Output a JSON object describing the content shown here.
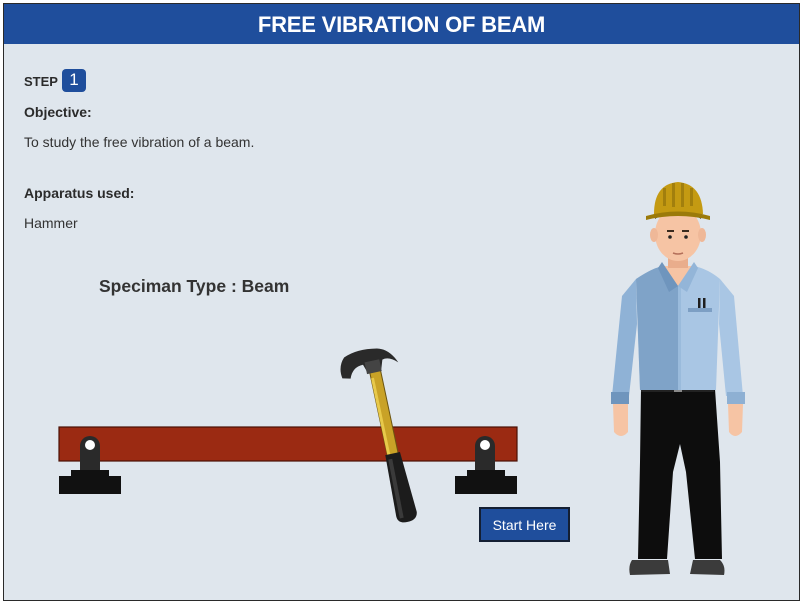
{
  "header": {
    "title": "FREE VIBRATION OF BEAM"
  },
  "step": {
    "label": "STEP",
    "number": "1"
  },
  "objective": {
    "heading": "Objective:",
    "text": "To study the free vibration of a beam."
  },
  "apparatus": {
    "heading": "Apparatus used:",
    "text": "Hammer"
  },
  "specimen": {
    "label": "Speciman Type : Beam"
  },
  "actions": {
    "start_label": "Start Here"
  },
  "colors": {
    "header": "#1f4e9c",
    "background": "#dfe6ed",
    "beam": "#9b2a12",
    "button": "#1f4e9c"
  },
  "icons": [
    "beam-support-icon",
    "hammer-icon",
    "engineer-figure-icon"
  ]
}
